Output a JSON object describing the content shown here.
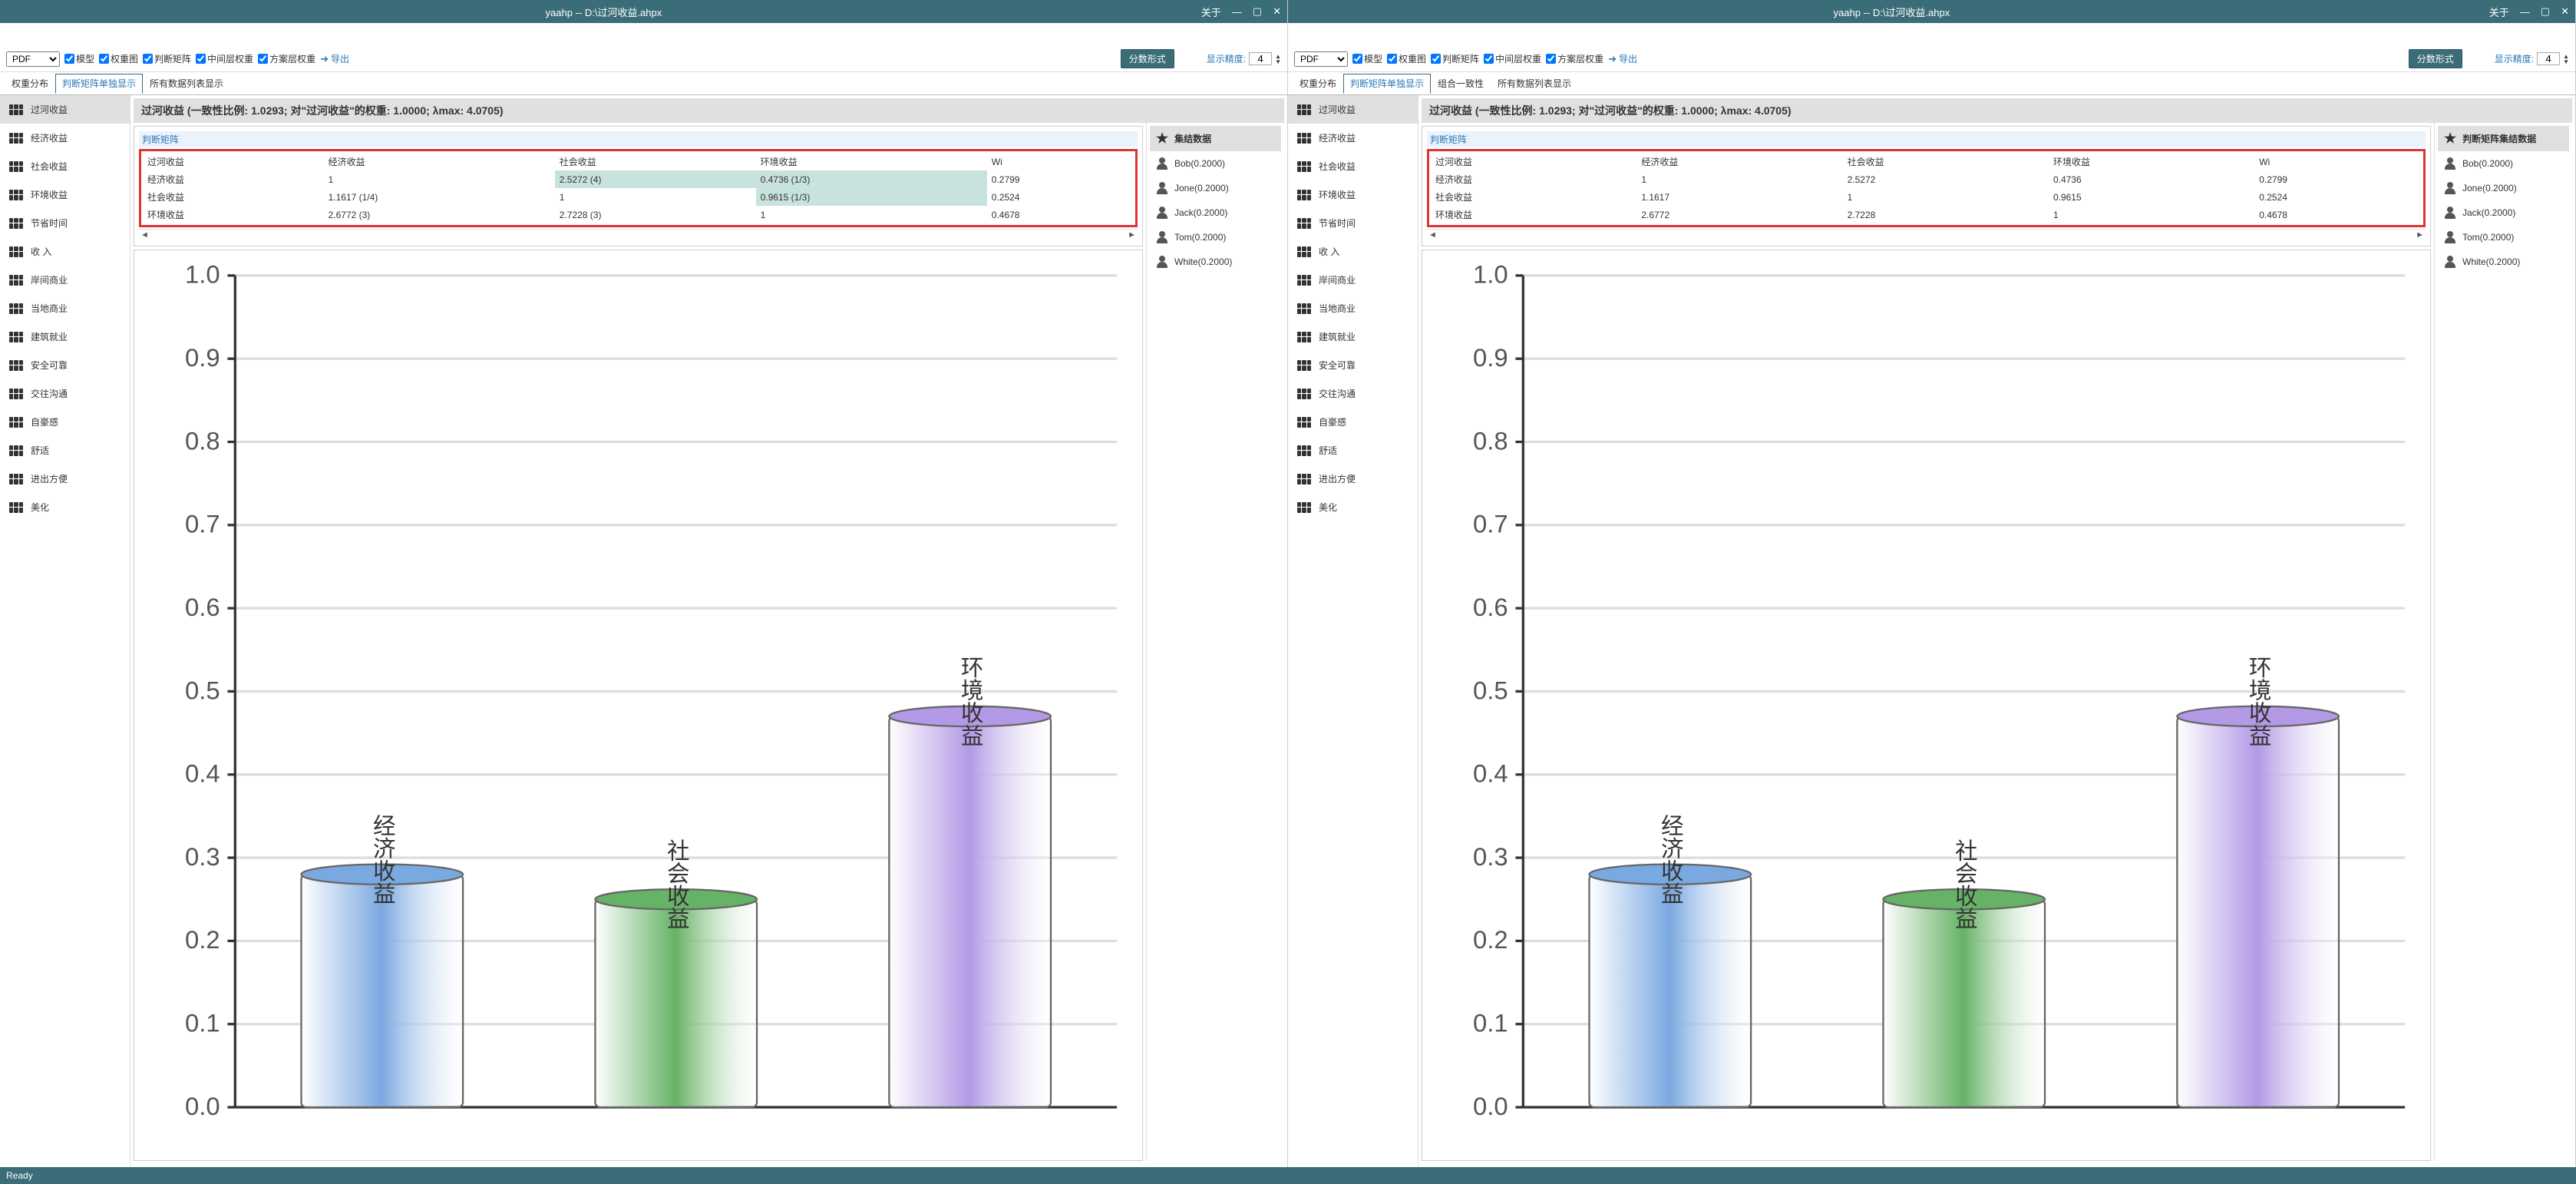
{
  "title": "yaahp  --  D:\\过河收益.ahpx",
  "menulink": "关于",
  "toolbar": {
    "format": "PDF",
    "cb_model": "模型",
    "cb_weight_chart": "权重图",
    "cb_judge_matrix": "判断矩阵",
    "cb_mid_weight": "中间层权重",
    "cb_scheme_weight": "方案层权重",
    "export": "导出",
    "fraction_form": "分数形式",
    "precision_label": "显示精度:",
    "precision_value": "4"
  },
  "tabs_left": [
    "权重分布",
    "判断矩阵单独显示",
    "所有数据列表显示"
  ],
  "tabs_right": [
    "权重分布",
    "判断矩阵单独显示",
    "组合一致性",
    "所有数据列表显示"
  ],
  "active_tab": "判断矩阵单独显示",
  "sidebar_items": [
    "过河收益",
    "经济收益",
    "社会收益",
    "环境收益",
    "节省时间",
    "收  入",
    "岸间商业",
    "当地商业",
    "建筑就业",
    "安全可靠",
    "交往沟通",
    "自豪感",
    "舒适",
    "进出方便",
    "美化"
  ],
  "main_header": "过河收益  (一致性比例: 1.0293; 对\"过河收益\"的权重: 1.0000; λmax: 4.0705)",
  "matrix_label": "判断矩阵",
  "matrix": {
    "headers": [
      "过河收益",
      "经济收益",
      "社会收益",
      "环境收益",
      "Wi"
    ],
    "rows_left": [
      [
        "经济收益",
        "1",
        "2.5272 (4)",
        "0.4736 (1/3)",
        "0.2799"
      ],
      [
        "社会收益",
        "1.1617 (1/4)",
        "1",
        "0.9615 (1/3)",
        "0.2524"
      ],
      [
        "环境收益",
        "2.6772 (3)",
        "2.7228 (3)",
        "1",
        "0.4678"
      ]
    ],
    "rows_right": [
      [
        "经济收益",
        "1",
        "2.5272",
        "0.4736",
        "0.2799"
      ],
      [
        "社会收益",
        "1.1617",
        "1",
        "0.9615",
        "0.2524"
      ],
      [
        "环境收益",
        "2.6772",
        "2.7228",
        "1",
        "0.4678"
      ]
    ],
    "hl_left": [
      [
        0,
        2
      ],
      [
        0,
        3
      ],
      [
        1,
        3
      ]
    ]
  },
  "aggregate_left": "集结数据",
  "aggregate_right": "判断矩阵集结数据",
  "people": [
    "Bob(0.2000)",
    "Jone(0.2000)",
    "Jack(0.2000)",
    "Tom(0.2000)",
    "White(0.2000)"
  ],
  "status": "Ready",
  "chart_data": {
    "type": "bar",
    "categories": [
      "经济收益",
      "社会收益",
      "环境收益"
    ],
    "values": [
      0.28,
      0.25,
      0.47
    ],
    "ylim": [
      0,
      1.0
    ],
    "yticks": [
      0.0,
      0.1,
      0.2,
      0.3,
      0.4,
      0.5,
      0.6,
      0.7,
      0.8,
      0.9,
      1.0
    ],
    "colors": [
      "#7aa8e0",
      "#66b266",
      "#b399e6"
    ]
  }
}
